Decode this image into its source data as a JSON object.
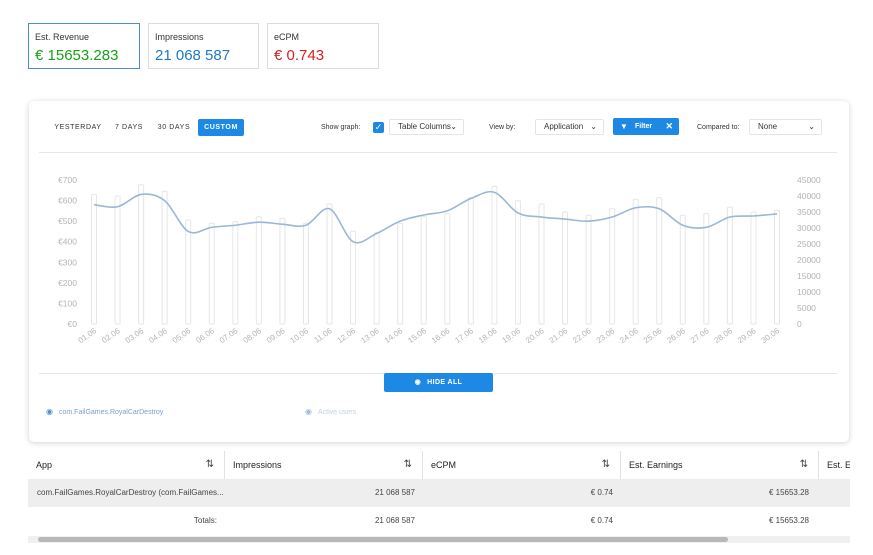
{
  "stats": [
    {
      "label": "Est. Revenue",
      "value": "€ 15653.283",
      "color": "#18a018"
    },
    {
      "label": "Impressions",
      "value": "21 068 587",
      "color": "#1f78c8"
    },
    {
      "label": "eCPM",
      "value": "€ 0.743",
      "color": "#d42020"
    }
  ],
  "toolbar": {
    "periods": [
      "YESTERDAY",
      "7 DAYS",
      "30 DAYS",
      "CUSTOM"
    ],
    "active_period": "CUSTOM",
    "show_graph_label": "Show graph:",
    "show_graph_checked": true,
    "columns_select": "Table Columns",
    "view_by_label": "View by:",
    "view_by_value": "Application",
    "filter_label": "Filter",
    "compared_label": "Compared to:",
    "compared_value": "None"
  },
  "chart_data": {
    "type": "line",
    "x": [
      "01.06",
      "02.06",
      "03.06",
      "04.06",
      "05.06",
      "06.06",
      "07.06",
      "08.06",
      "09.06",
      "10.06",
      "11.06",
      "12.06",
      "13.06",
      "14.06",
      "15.06",
      "16.06",
      "17.06",
      "18.06",
      "19.06",
      "20.06",
      "21.06",
      "22.06",
      "23.06",
      "24.06",
      "25.06",
      "26.06",
      "27.06",
      "28.06",
      "29.06",
      "30.06"
    ],
    "left_ticks": [
      "€700",
      "€600",
      "€500",
      "€400",
      "€300",
      "€200",
      "€100",
      "€0"
    ],
    "right_ticks": [
      "45000",
      "40000",
      "35000",
      "30000",
      "25000",
      "20000",
      "15000",
      "10000",
      "5000",
      "0"
    ],
    "ylim_left": [
      0,
      700
    ],
    "ylim_right": [
      0,
      45000
    ],
    "series": [
      {
        "name": "com.FailGames.RoyalCarDestroy",
        "axis": "left",
        "values": [
          580,
          570,
          630,
          600,
          450,
          470,
          480,
          495,
          485,
          480,
          560,
          400,
          440,
          500,
          530,
          550,
          610,
          640,
          540,
          520,
          510,
          500,
          520,
          565,
          560,
          480,
          470,
          520,
          525,
          535
        ]
      },
      {
        "axis": "right",
        "values": [
          40500,
          40000,
          43500,
          41500,
          32500,
          31500,
          32000,
          33500,
          33000,
          31500,
          37500,
          29000,
          28500,
          31500,
          33500,
          34500,
          39500,
          43000,
          38500,
          37500,
          35000,
          34000,
          36000,
          39000,
          39500,
          34000,
          34500,
          36500,
          35000,
          35500
        ]
      }
    ],
    "line_color": "#9bb6d6",
    "bar_color": "#e6e6e6",
    "grid": false
  },
  "hide_all_label": "HIDE ALL",
  "legend": [
    {
      "label": "com.FailGames.RoyalCarDestroy",
      "color": "#7c9cc8"
    },
    {
      "label": "Active users",
      "color": "#d4dce6"
    }
  ],
  "table": {
    "headers": [
      "App",
      "Impressions",
      "eCPM",
      "Est. Earnings",
      "Est. Ea"
    ],
    "rows": [
      {
        "app": "com.FailGames.RoyalCarDestroy (com.FailGames...",
        "impressions": "21 068 587",
        "ecpm": "€ 0.74",
        "earnings": "€ 15653.28"
      }
    ],
    "totals": {
      "label": "Totals:",
      "impressions": "21 068 587",
      "ecpm": "€ 0.74",
      "earnings": "€ 15653.28"
    }
  }
}
